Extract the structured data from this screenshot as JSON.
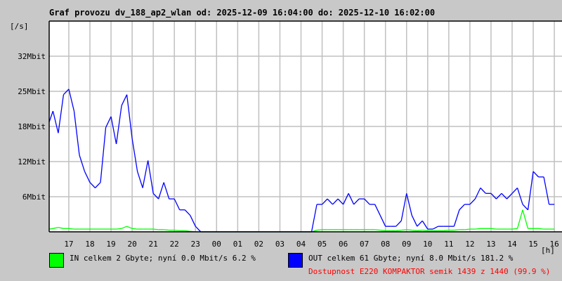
{
  "title": "Graf provozu dv_188_ap2_wlan od: 2025-12-09 16:04:00 do: 2025-12-10 16:02:00",
  "legend": {
    "in": {
      "label": "IN celkem 2 Gbyte; nyní    0.0 Mbit/s 6.2 %",
      "color": "#00ff00"
    },
    "out": {
      "label": "OUT celkem 61 Gbyte; nyní   8.0 Mbit/s 181.2 %",
      "color": "#0000ff"
    },
    "availability": "Dostupnost E220 KOMPAKTOR semik 1439 z 1440 (99.9 %)"
  },
  "chart_data": {
    "type": "line",
    "title": "Graf provozu dv_188_ap2_wlan od: 2025-12-09 16:04:00 do: 2025-12-10 16:02:00",
    "ylabel": "[/s]",
    "xlabel": "[h]",
    "y_unit": "Mbit",
    "ylim": [
      0,
      38.4
    ],
    "xlim_hours": [
      16.07,
      40.03
    ],
    "y_ticks": [
      {
        "value": 6.4,
        "label": "6Mbit"
      },
      {
        "value": 12.8,
        "label": "12Mbit"
      },
      {
        "value": 19.2,
        "label": "18Mbit"
      },
      {
        "value": 25.6,
        "label": "25Mbit"
      },
      {
        "value": 32,
        "label": "32Mbit"
      }
    ],
    "x_ticks": [
      "17",
      "18",
      "19",
      "20",
      "21",
      "22",
      "23",
      "00",
      "01",
      "02",
      "03",
      "04",
      "05",
      "06",
      "07",
      "08",
      "09",
      "10",
      "11",
      "12",
      "13",
      "14",
      "15",
      "16"
    ],
    "grid": true,
    "x_start_hour": 16,
    "x_step_hours": 0.25,
    "series": [
      {
        "name": "OUT",
        "color": "#0000ff",
        "values": [
          20,
          22,
          18,
          25,
          26,
          22,
          14,
          11,
          9,
          8,
          9,
          19,
          21,
          16,
          23,
          25,
          17,
          11,
          8,
          13,
          7,
          6,
          9,
          6,
          6,
          4,
          4,
          3,
          1,
          0,
          0,
          0,
          0,
          0,
          0,
          0,
          0,
          0,
          0,
          0,
          0,
          0,
          0,
          0,
          0,
          0,
          0,
          0,
          0,
          0,
          0,
          5,
          5,
          6,
          5,
          6,
          5,
          7,
          5,
          6,
          6,
          5,
          5,
          3,
          1,
          1,
          1,
          2,
          7,
          3,
          1,
          2,
          0.5,
          0.5,
          1,
          1,
          1,
          1,
          4,
          5,
          5,
          6,
          8,
          7,
          7,
          6,
          7,
          6,
          7,
          8,
          5,
          4,
          11,
          10,
          10,
          5,
          5
        ]
      },
      {
        "name": "IN",
        "color": "#00ff00",
        "values": [
          0.5,
          0.6,
          0.8,
          0.6,
          0.6,
          0.5,
          0.5,
          0.5,
          0.5,
          0.5,
          0.5,
          0.5,
          0.5,
          0.5,
          0.6,
          1,
          0.6,
          0.5,
          0.5,
          0.5,
          0.5,
          0.4,
          0.4,
          0.3,
          0.3,
          0.2,
          0.2,
          0.1,
          0,
          0,
          0,
          0,
          0,
          0,
          0,
          0,
          0,
          0,
          0,
          0,
          0,
          0,
          0,
          0,
          0,
          0,
          0,
          0,
          0,
          0,
          0,
          0.3,
          0.4,
          0.4,
          0.4,
          0.4,
          0.4,
          0.4,
          0.4,
          0.4,
          0.4,
          0.4,
          0.4,
          0.3,
          0.2,
          0.2,
          0.2,
          0.3,
          0.4,
          0.3,
          0.2,
          0.3,
          0.2,
          0.2,
          0.2,
          0.2,
          0.3,
          0.3,
          0.4,
          0.4,
          0.5,
          0.5,
          0.6,
          0.6,
          0.6,
          0.5,
          0.5,
          0.5,
          0.5,
          0.6,
          4,
          0.6,
          0.6,
          0.6,
          0.5,
          0.5,
          0.5
        ]
      }
    ]
  }
}
